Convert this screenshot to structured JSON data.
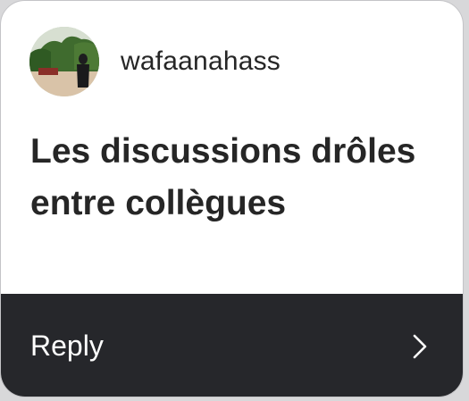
{
  "story_reply": {
    "username": "wafaanahass",
    "title": "Les discussions drôles entre collègues",
    "reply_label": "Reply",
    "icons": {
      "avatar": "profile-photo",
      "reply_chevron": "chevron-right-icon"
    },
    "colors": {
      "card_background": "#ffffff",
      "reply_bar_background": "#26272b",
      "text_dark": "#262626",
      "text_light": "#ffffff"
    }
  }
}
